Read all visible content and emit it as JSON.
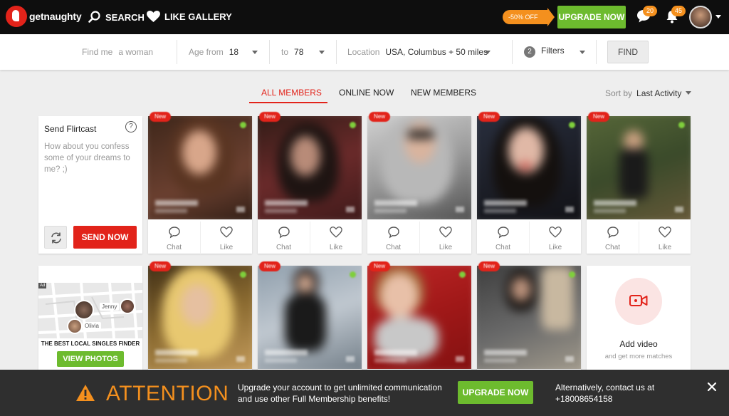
{
  "brand": {
    "name": "getnaughty"
  },
  "nav": {
    "search_label": "SEARCH",
    "gallery_label": "LIKE GALLERY"
  },
  "header": {
    "promo_label": "-50% OFF",
    "upgrade_label": "UPGRADE NOW",
    "messages_count": "20",
    "notifications_count": "45"
  },
  "search": {
    "find_me_label": "Find me",
    "find_me_value": "a woman",
    "age_from_label": "Age from",
    "age_from_value": "18",
    "age_to_label": "to",
    "age_to_value": "78",
    "location_label": "Location",
    "location_value": "USA, Columbus + 50 miles",
    "filters_count": "2",
    "filters_label": "Filters",
    "find_label": "FIND"
  },
  "tabs": {
    "all": "ALL MEMBERS",
    "online": "ONLINE NOW",
    "new": "NEW MEMBERS",
    "sort_label": "Sort by",
    "sort_value": "Last Activity"
  },
  "flirtcast": {
    "title": "Send Flirtcast",
    "help": "?",
    "message": "How about you confess some of your dreams to me? ;)",
    "send_label": "SEND NOW"
  },
  "card_actions": {
    "chat": "Chat",
    "like": "Like"
  },
  "new_badge": "New",
  "ad": {
    "tag": "Ad",
    "pin_label_1": "Jenny",
    "pin_label_2": "Olivia",
    "title": "THE BEST LOCAL SINGLES FINDER",
    "button": "VIEW PHOTOS"
  },
  "add_video": {
    "title": "Add video",
    "subtitle": "and get more matches"
  },
  "attention": {
    "title": "ATTENTION",
    "message": "Upgrade your account to get unlimited communication and use other Full Membership benefits!",
    "button": "UPGRADE NOW",
    "contact_line1": "Alternatively, contact us at",
    "contact_line2": "+18008654158"
  },
  "colors": {
    "brand_red": "#e2231a",
    "upgrade_green": "#6dbb2e",
    "promo_orange": "#f4901e",
    "topbar_bg": "#0e0e0e",
    "banner_bg": "#2f2f2f"
  },
  "icons": {
    "search": "search-icon",
    "gallery": "heart-icon",
    "messages": "chat-bubble-icon",
    "notifications": "bell-icon",
    "chat": "chat-bubble-outline-icon",
    "like": "heart-outline-icon",
    "refresh": "refresh-icon",
    "video": "video-camera-icon",
    "warning": "warning-triangle-icon",
    "close": "close-icon"
  }
}
